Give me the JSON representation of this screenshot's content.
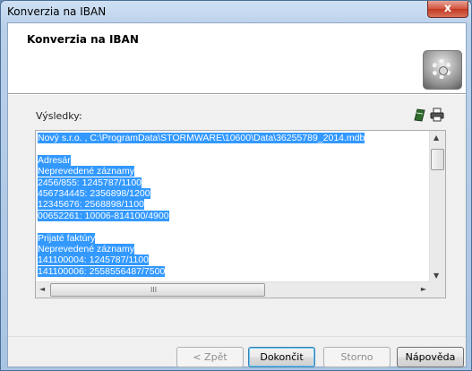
{
  "window": {
    "title": "Konverzia na IBAN",
    "close_glyph": "x"
  },
  "header": {
    "title": "Konverzia na IBAN",
    "icon": "gear-icon"
  },
  "results": {
    "label": "Výsledky:",
    "tool_icons": [
      "flag-icon",
      "print-icon"
    ],
    "lines": [
      "Nový s.r.o. , C:\\ProgramData\\STORMWARE\\10600\\Data\\36255789_2014.mdb",
      "",
      "Adresár",
      "Neprevedené záznamy",
      "2456/855: 1245787/1100",
      "456734445: 2356898/1200",
      "12345676: 2568898/1100",
      "00652261: 10006-814100/4900",
      "",
      "Prijaté faktúry",
      "Neprevedené záznamy",
      "141100004: 1245787/1100",
      "141100006: 2558556487/7500"
    ],
    "hscroll_glyph": "III"
  },
  "buttons": {
    "back": "< Zpět",
    "finish": "Dokončit",
    "cancel": "Storno",
    "help": "Nápověda"
  }
}
